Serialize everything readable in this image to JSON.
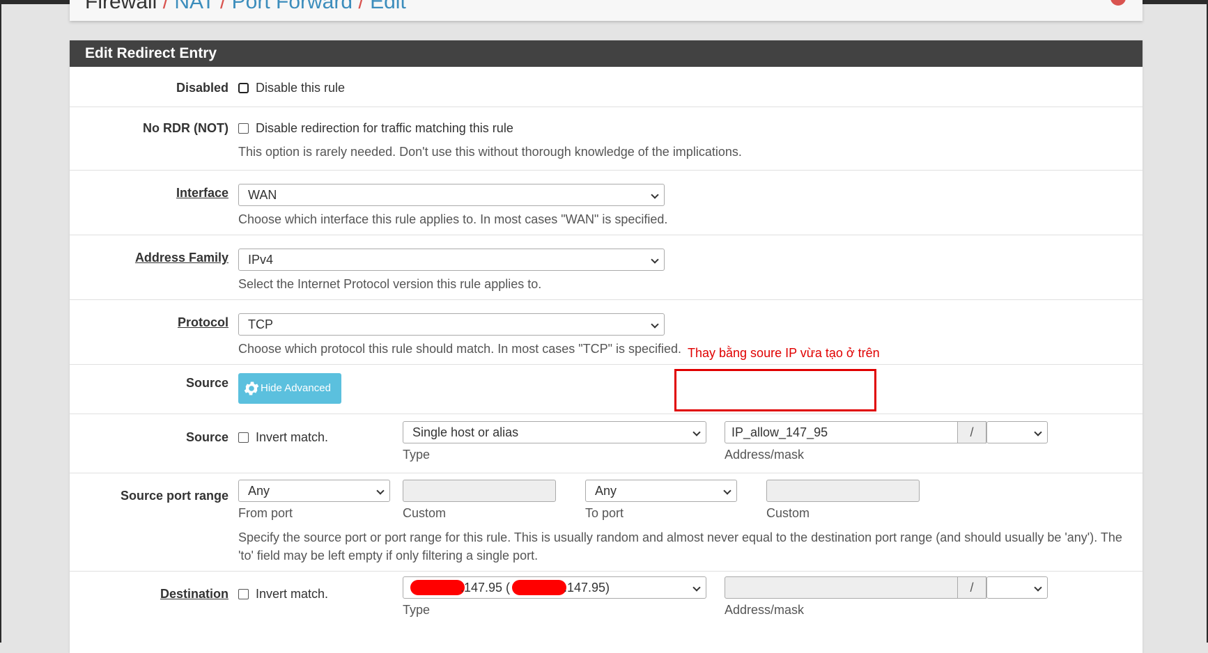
{
  "breadcrumb": {
    "root": "Firewall",
    "items": [
      "NAT",
      "Port Forward",
      "Edit"
    ],
    "separator": "/"
  },
  "panel_title": "Edit Redirect Entry",
  "disabled": {
    "label": "Disabled",
    "checkbox_label": "Disable this rule",
    "checked": false
  },
  "no_rdr": {
    "label": "No RDR (NOT)",
    "checkbox_label": "Disable redirection for traffic matching this rule",
    "help": "This option is rarely needed. Don't use this without thorough knowledge of the implications.",
    "checked": false
  },
  "interface": {
    "label": "Interface",
    "value": "WAN",
    "help": "Choose which interface this rule applies to. In most cases \"WAN\" is specified."
  },
  "address_family": {
    "label": "Address Family",
    "value": "IPv4",
    "help": "Select the Internet Protocol version this rule applies to."
  },
  "protocol": {
    "label": "Protocol",
    "value": "TCP",
    "help": "Choose which protocol this rule should match. In most cases \"TCP\" is specified."
  },
  "source_advanced": {
    "label": "Source",
    "button_label": "Hide Advanced"
  },
  "source": {
    "label": "Source",
    "invert_label": "Invert match.",
    "type_value": "Single host or alias",
    "type_caption": "Type",
    "address_value": "IP_allow_147_95",
    "address_caption": "Address/mask",
    "slash": "/",
    "mask_value": ""
  },
  "source_port_range": {
    "label": "Source port range",
    "from_value": "Any",
    "from_caption": "From port",
    "custom_caption": "Custom",
    "to_value": "Any",
    "to_caption": "To port",
    "to_custom_caption": "Custom",
    "help": "Specify the source port or port range for this rule. This is usually random and almost never equal to the destination port range (and should usually be 'any'). The 'to' field may be left empty if only filtering a single port."
  },
  "destination": {
    "label": "Destination",
    "invert_label": "Invert match.",
    "type_value_part1": ".147.95 (",
    "type_value_part2": ".147.95)",
    "type_caption": "Type",
    "address_caption": "Address/mask",
    "slash": "/"
  },
  "annotation": {
    "text": "Thay bằng soure IP vừa tạo ở trên"
  },
  "colors": {
    "accent_info": "#5bc0de",
    "panel_heading": "#424242",
    "link": "#3c8dbc",
    "breadcrumb_separator": "#d9534f",
    "annotation": "#e00000"
  }
}
